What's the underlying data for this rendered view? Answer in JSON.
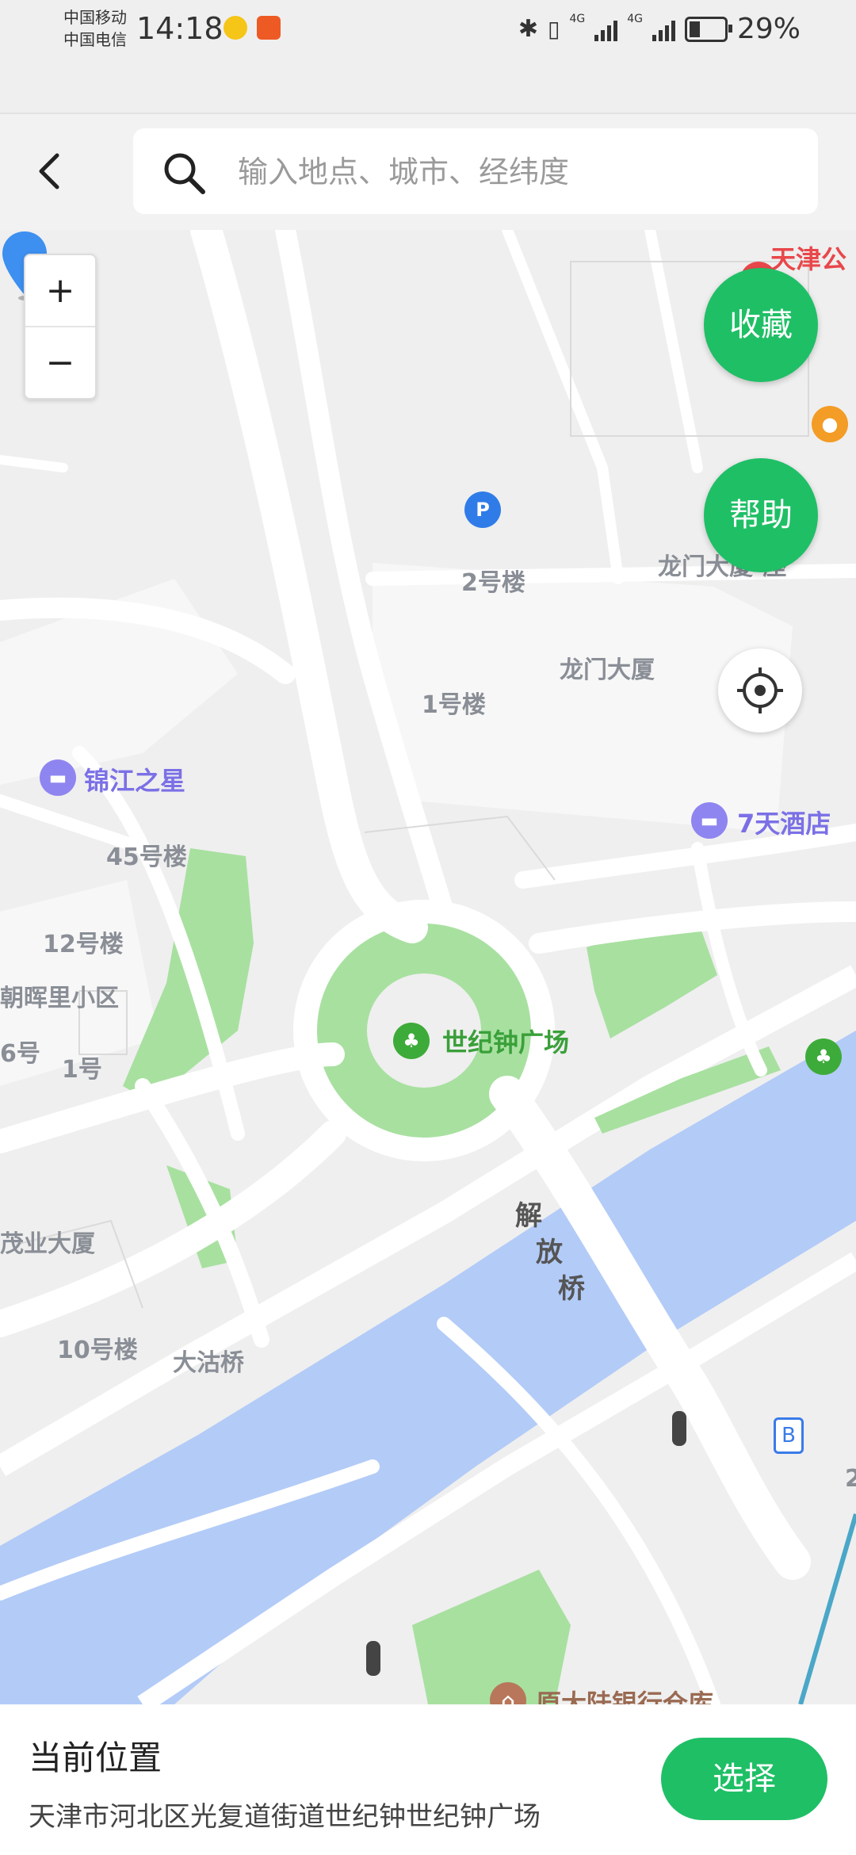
{
  "status_bar": {
    "carrier_1": "中国移动",
    "carrier_2": "中国电信",
    "time": "14:18",
    "battery": "29%",
    "network_1": "4G",
    "network_2": "4G"
  },
  "search": {
    "placeholder": "输入地点、城市、经纬度"
  },
  "map": {
    "zoom_in": "+",
    "zoom_out": "−",
    "favorite_button": "收藏",
    "help_button": "帮助",
    "labels": {
      "building_2": "2号楼",
      "building_1": "1号楼",
      "longmen": "龙门大厦",
      "longmen_annex": "龙门大厦-座",
      "jinjiang": "锦江之星",
      "seven_days": "7天酒店",
      "b45": "45号楼",
      "b12": "12号楼",
      "chaohui": "朝晖里小区",
      "b6": "6号",
      "b1": "1号",
      "century_plaza": "世纪钟广场",
      "maoye": "茂业大厦",
      "b10": "10号楼",
      "dagu_bridge": "大沽桥",
      "jiefang_1": "解",
      "jiefang_2": "放",
      "jiefang_3": "桥",
      "warehouse": "原大陆银行仓库",
      "tianjin_top": "天津公",
      "bus_stop": "B",
      "parking": "P",
      "partial_2": "2"
    }
  },
  "bottom_panel": {
    "title": "当前位置",
    "address": "天津市河北区光复道街道世纪钟世纪钟广场",
    "select_button": "选择"
  },
  "colors": {
    "accent": "#1fbf66",
    "water": "#b3cbf7",
    "green": "#a8e0a0",
    "poi_purple": "#8f85f0"
  }
}
